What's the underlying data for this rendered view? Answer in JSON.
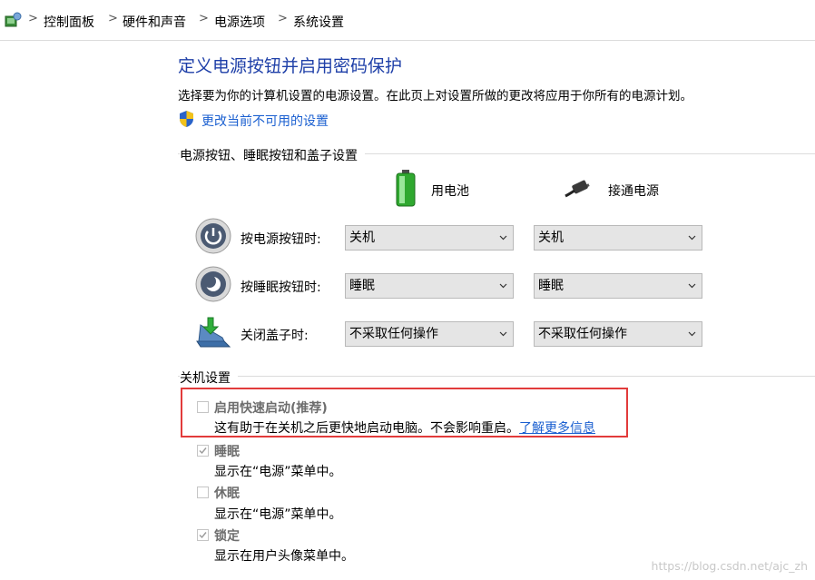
{
  "breadcrumb": {
    "items": [
      "控制面板",
      "硬件和声音",
      "电源选项",
      "系统设置"
    ],
    "separator": ">"
  },
  "page": {
    "title": "定义电源按钮并启用密码保护",
    "description": "选择要为你的计算机设置的电源设置。在此页上对设置所做的更改将应用于你所有的电源计划。",
    "change_link": "更改当前不可用的设置"
  },
  "buttons_section": {
    "heading": "电源按钮、睡眠按钮和盖子设置",
    "columns": {
      "battery": "用电池",
      "plugged": "接通电源"
    },
    "rows": [
      {
        "label": "按电源按钮时:",
        "battery": "关机",
        "plugged": "关机",
        "icon": "power-button-icon"
      },
      {
        "label": "按睡眠按钮时:",
        "battery": "睡眠",
        "plugged": "睡眠",
        "icon": "sleep-button-icon"
      },
      {
        "label": "关闭盖子时:",
        "battery": "不采取任何操作",
        "plugged": "不采取任何操作",
        "icon": "laptop-lid-icon"
      }
    ]
  },
  "shutdown_section": {
    "heading": "关机设置",
    "options": [
      {
        "title": "启用快速启动(推荐)",
        "desc": "这有助于在关机之后更快地启动电脑。不会影响重启。",
        "link": "了解更多信息",
        "checked": false
      },
      {
        "title": "睡眠",
        "desc": "显示在“电源”菜单中。",
        "checked": true
      },
      {
        "title": "休眠",
        "desc": "显示在“电源”菜单中。",
        "checked": false
      },
      {
        "title": "锁定",
        "desc": "显示在用户头像菜单中。",
        "checked": true
      }
    ]
  },
  "watermark": "https://blog.csdn.net/ajc_zh",
  "colors": {
    "title_blue": "#1e3fa8",
    "link_blue": "#1a5fd0",
    "highlight_red": "#e23b3b",
    "disabled_text": "#6d6d6d",
    "select_bg": "#e5e5e5"
  }
}
